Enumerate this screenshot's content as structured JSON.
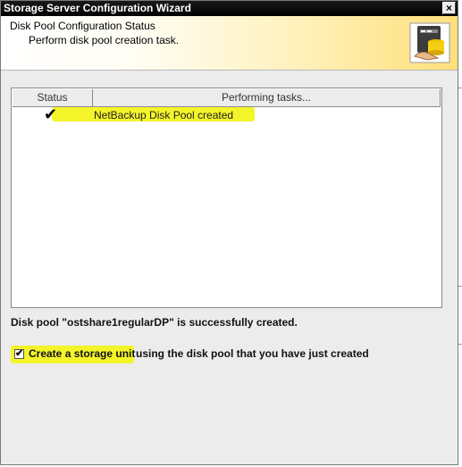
{
  "window": {
    "title": "Storage Server Configuration Wizard",
    "close_label": "×"
  },
  "header": {
    "title": "Disk Pool Configuration Status",
    "subtitle": "Perform disk pool creation task.",
    "icon": "storage-server-icon"
  },
  "table": {
    "columns": [
      "Status",
      "Performing tasks..."
    ],
    "rows": [
      {
        "status_icon": "checkmark-icon",
        "status_glyph": "✔",
        "task": "NetBackup Disk Pool created"
      }
    ]
  },
  "status_message": "Disk pool \"ostshare1regularDP\" is successfully created.",
  "storage_unit_option": {
    "checked": true,
    "check_glyph": "✔",
    "label_highlighted": "Create a storage unit",
    "label_rest": " using the disk pool that you have just created"
  },
  "colors": {
    "highlight": "#f4f42a",
    "titlebar": "#000000",
    "header_gradient_end": "#ffe07a"
  }
}
